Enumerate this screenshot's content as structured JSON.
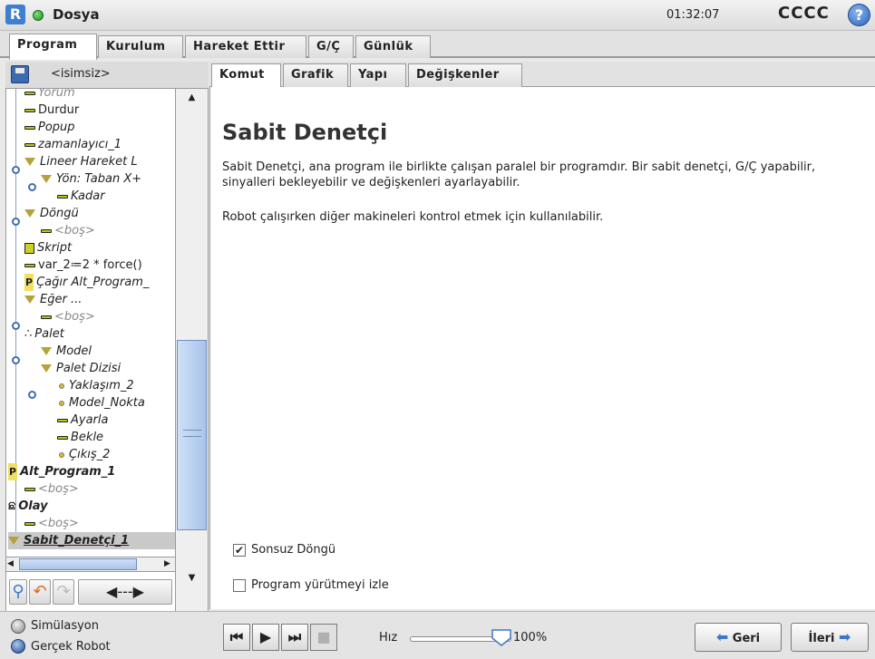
{
  "titlebar": {
    "app_title": "Dosya",
    "clock": "01:32:07",
    "robot_name": "CCCC",
    "help_label": "?"
  },
  "main_tabs": [
    "Program",
    "Kurulum",
    "Hareket Ettir",
    "G/Ç",
    "Günlük"
  ],
  "file": {
    "name": "<isimsiz>"
  },
  "tree": [
    {
      "label": "Yorum"
    },
    {
      "label": "Durdur"
    },
    {
      "label": "Popup"
    },
    {
      "label": "zamanlayıcı_1"
    },
    {
      "label": "Lineer Hareket L"
    },
    {
      "label": "Yön: Taban X+"
    },
    {
      "label": "Kadar"
    },
    {
      "label": "Döngü"
    },
    {
      "label": "<boş>"
    },
    {
      "label": "Skript"
    },
    {
      "label": "var_2≔2 * force()"
    },
    {
      "label": "Çağır Alt_Program_"
    },
    {
      "label": "Eğer ..."
    },
    {
      "label": "<boş>"
    },
    {
      "label": "Palet"
    },
    {
      "label": "Model"
    },
    {
      "label": "Palet Dizisi"
    },
    {
      "label": "Yaklaşım_2"
    },
    {
      "label": "Model_Nokta"
    },
    {
      "label": "Ayarla"
    },
    {
      "label": "Bekle"
    },
    {
      "label": "Çıkış_2"
    },
    {
      "label": "Alt_Program_1"
    },
    {
      "label": "<boş>"
    },
    {
      "label": "Olay"
    },
    {
      "label": "<boş>"
    },
    {
      "label": "Sabit_Denetçi_1"
    }
  ],
  "sub_tabs": [
    "Komut",
    "Grafik",
    "Yapı",
    "Değişkenler"
  ],
  "content": {
    "heading": "Sabit Denetçi",
    "description": "Sabit Denetçi, ana program ile birlikte çalışan paralel bir programdır. Bir sabit denetçi, G/Ç yapabilir, sinyalleri bekleyebilir ve değişkenleri ayarlayabilir.",
    "description2": "Robot çalışırken diğer makineleri kontrol etmek için kullanılabilir.",
    "loop_checkbox": {
      "label": "Sonsuz Döngü",
      "checked": true
    },
    "trace_checkbox": {
      "label": "Program yürütmeyi izle",
      "checked": false
    }
  },
  "bottom": {
    "mode_sim": "Simülasyon",
    "mode_real": "Gerçek Robot",
    "speed_label": "Hız",
    "speed_value": "100%",
    "speed_fraction": 1.0,
    "back_label": "Geri",
    "next_label": "İleri"
  },
  "colors": {
    "accent": "#3c78c8",
    "status_green": "#1f8a1f"
  }
}
